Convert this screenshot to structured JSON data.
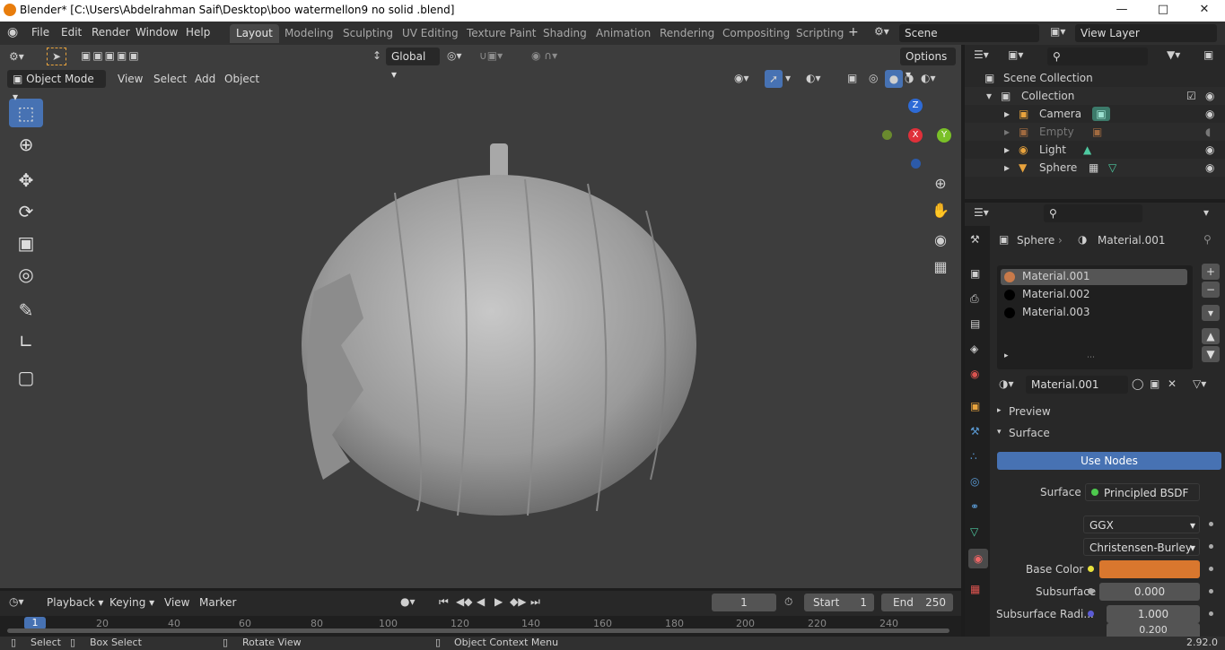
{
  "title_bar": {
    "title": "Blender* [C:\\Users\\Abdelrahman Saif\\Desktop\\boo watermellon9 no solid .blend]"
  },
  "menu": {
    "file": "File",
    "edit": "Edit",
    "render": "Render",
    "window": "Window",
    "help": "Help"
  },
  "workspaces": [
    "Layout",
    "Modeling",
    "Sculpting",
    "UV Editing",
    "Texture Paint",
    "Shading",
    "Animation",
    "Rendering",
    "Compositing",
    "Scripting"
  ],
  "scene": {
    "name": "Scene",
    "view_layer": "View Layer"
  },
  "viewport": {
    "orientation": "Global",
    "options": "Options",
    "mode": "Object Mode",
    "menu_view": "View",
    "menu_select": "Select",
    "menu_add": "Add",
    "menu_object": "Object",
    "gizmo": {
      "z": "Z",
      "x": "X",
      "y": "Y"
    }
  },
  "outliner": {
    "scene_collection": "Scene Collection",
    "collection": "Collection",
    "items": [
      {
        "name": "Camera"
      },
      {
        "name": "Empty"
      },
      {
        "name": "Light"
      },
      {
        "name": "Sphere"
      }
    ]
  },
  "properties": {
    "object": "Sphere",
    "material": "Material.001",
    "slots": [
      "Material.001",
      "Material.002",
      "Material.003"
    ],
    "active_material": "Material.001",
    "preview": "Preview",
    "surface": "Surface",
    "use_nodes": "Use Nodes",
    "surface_label": "Surface",
    "surface_value": "Principled BSDF",
    "distribution": "GGX",
    "subsurface_method": "Christensen-Burley",
    "base_color_label": "Base Color",
    "base_color": "#d9772e",
    "subsurface_label": "Subsurface",
    "subsurface_value": "0.000",
    "subsurface_radius_label": "Subsurface Radi...",
    "subsurface_radius_value": "1.000",
    "subsurface_radius_value2": "0.200"
  },
  "timeline": {
    "playback": "Playback",
    "keying": "Keying",
    "view": "View",
    "marker": "Marker",
    "current_frame": "1",
    "start_label": "Start",
    "start": "1",
    "end_label": "End",
    "end": "250",
    "ruler": [
      "1",
      "20",
      "40",
      "60",
      "80",
      "100",
      "120",
      "140",
      "160",
      "180",
      "200",
      "220",
      "240"
    ]
  },
  "status": {
    "select": "Select",
    "box_select": "Box Select",
    "rotate_view": "Rotate View",
    "context_menu": "Object Context Menu",
    "version": "2.92.0"
  }
}
